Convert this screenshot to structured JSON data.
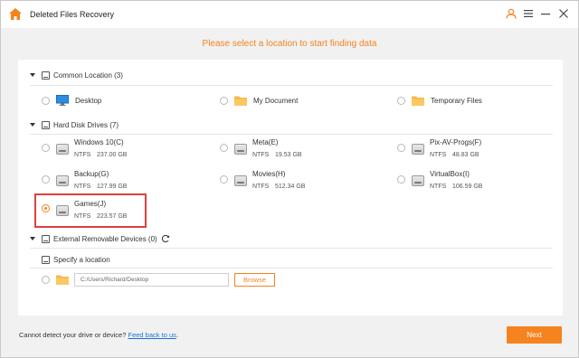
{
  "titlebar": {
    "title": "Deleted Files Recovery",
    "icons": [
      "home-icon",
      "user-icon",
      "menu-icon",
      "minimize-icon",
      "close-icon"
    ]
  },
  "headline": "Please select a location to start finding data",
  "common": {
    "heading": "Common Location (3)",
    "items": [
      {
        "label": "Desktop",
        "icon": "desktop-icon"
      },
      {
        "label": "My Document",
        "icon": "folder-icon"
      },
      {
        "label": "Temporary Files",
        "icon": "folder-icon"
      }
    ]
  },
  "hdd": {
    "heading": "Hard Disk Drives (7)",
    "drives": [
      {
        "name": "Windows 10(C)",
        "fs": "NTFS",
        "size": "237.00 GB",
        "selected": false
      },
      {
        "name": "Meta(E)",
        "fs": "NTFS",
        "size": "19.53 GB",
        "selected": false
      },
      {
        "name": "Pix-AV-Progs(F)",
        "fs": "NTFS",
        "size": "48.83 GB",
        "selected": false
      },
      {
        "name": "Backup(G)",
        "fs": "NTFS",
        "size": "127.99 GB",
        "selected": false
      },
      {
        "name": "Movies(H)",
        "fs": "NTFS",
        "size": "512.34 GB",
        "selected": false
      },
      {
        "name": "VirtualBox(I)",
        "fs": "NTFS",
        "size": "106.59 GB",
        "selected": false
      },
      {
        "name": "Games(J)",
        "fs": "NTFS",
        "size": "223.57 GB",
        "selected": true
      }
    ]
  },
  "removable": {
    "heading": "External Removable Devices (0)"
  },
  "specify": {
    "heading": "Specify a location",
    "path": "C:/Users/Richard/Desktop",
    "browse_label": "Browse"
  },
  "footer": {
    "text": "Cannot detect your drive or device?",
    "link": "Feed back to us",
    "period": ".",
    "next_label": "Next"
  },
  "colors": {
    "accent": "#f5831f",
    "highlight": "#e0403f",
    "link": "#1a73d9"
  }
}
